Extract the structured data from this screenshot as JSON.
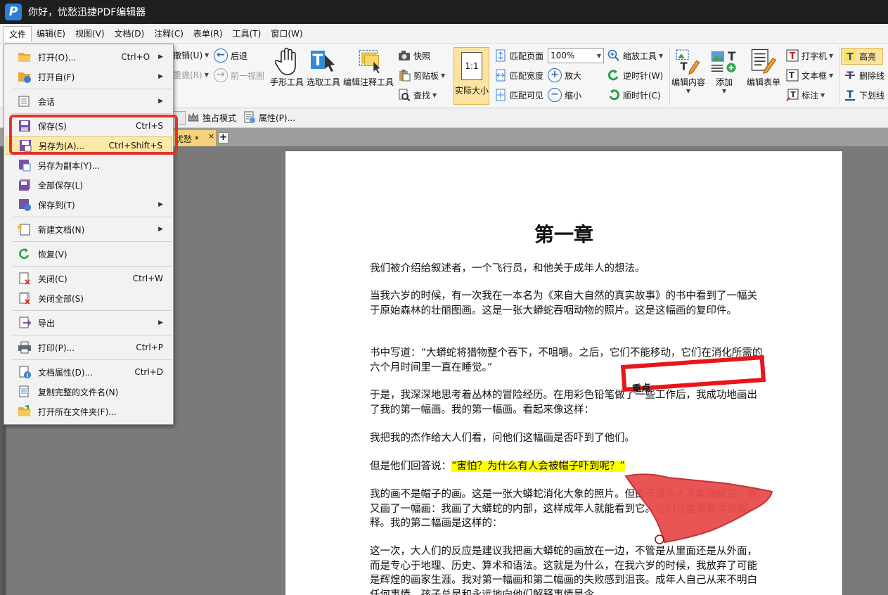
{
  "window": {
    "title": "你好，忧愁迅捷PDF编辑器",
    "logo": "P"
  },
  "menubar": [
    "文件",
    "编辑(E)",
    "视图(V)",
    "文档(D)",
    "注释(C)",
    "表单(R)",
    "工具(T)",
    "窗口(W)"
  ],
  "ribbon": {
    "undo": "撤销(U)",
    "redo": "重做(R)",
    "back": "后退",
    "forward": "前一视图",
    "hand_tool": "手形工具",
    "select_tool": "选取工具",
    "edit_annot_tool": "编辑注释工具",
    "snapshot": "快照",
    "clipboard": "剪贴板",
    "find": "查找",
    "actual_size": "实际大小",
    "actual_size_icon": "1:1",
    "fit_page": "匹配页面",
    "fit_width": "匹配宽度",
    "fit_visible": "匹配可见",
    "zoom_value": "100%",
    "zoom_tool": "缩放工具",
    "zoom_in": "放大",
    "zoom_out": "缩小",
    "rotate_ccw": "逆时针(W)",
    "rotate_cw": "顺时针(C)",
    "edit_content": "编辑内容",
    "add": "添加",
    "edit_form": "编辑表单",
    "typewriter": "打字机",
    "textbox": "文本框",
    "callout": "标注",
    "highlight": "高亮",
    "strikeout": "删除线",
    "underline": "下划线"
  },
  "subtoolbar": {
    "exclusive_mode": "独占模式",
    "properties": "属性(P)..."
  },
  "tab": {
    "label": "忧愁 *",
    "close": "×",
    "add": "+"
  },
  "file_menu": [
    {
      "label": "打开(O)...",
      "shortcut": "Ctrl+O",
      "arrow": true
    },
    {
      "label": "打开自(F)",
      "shortcut": "",
      "arrow": true
    },
    {
      "label": "会话",
      "shortcut": "",
      "arrow": true
    },
    {
      "label": "保存(S)",
      "shortcut": "Ctrl+S",
      "arrow": false
    },
    {
      "label": "另存为(A)...",
      "shortcut": "Ctrl+Shift+S",
      "arrow": false
    },
    {
      "label": "另存为副本(Y)...",
      "shortcut": "",
      "arrow": false
    },
    {
      "label": "全部保存(L)",
      "shortcut": "",
      "arrow": false
    },
    {
      "label": "保存到(T)",
      "shortcut": "",
      "arrow": true
    },
    {
      "label": "新建文档(N)",
      "shortcut": "",
      "arrow": true
    },
    {
      "label": "恢复(V)",
      "shortcut": "",
      "arrow": false
    },
    {
      "label": "关闭(C)",
      "shortcut": "Ctrl+W",
      "arrow": false
    },
    {
      "label": "关闭全部(S)",
      "shortcut": "",
      "arrow": false
    },
    {
      "label": "导出",
      "shortcut": "",
      "arrow": true
    },
    {
      "label": "打印(P)...",
      "shortcut": "Ctrl+P",
      "arrow": false
    },
    {
      "label": "文档属性(D)...",
      "shortcut": "Ctrl+D",
      "arrow": false
    },
    {
      "label": "复制完整的文件名(N)",
      "shortcut": "",
      "arrow": false
    },
    {
      "label": "打开所在文件夹(F)...",
      "shortcut": "",
      "arrow": false
    }
  ],
  "document": {
    "title": "第一章",
    "paragraphs": [
      "我们被介绍给叙述者，一个飞行员，和他关于成年人的想法。",
      "当我六岁的时候，有一次我在一本名为《来自大自然的真实故事》的书中看到了一幅关于原始森林的壮丽图画。这是一张大蟒蛇吞咽动物的照片。这是这幅画的复印件。",
      "书中写道：“大蟒蛇将猎物整个吞下，不咀嚼。之后，它们不能移动，它们在消化所需的六个月时间里一直在睡觉。”",
      "于是，我深深地思考着丛林的冒险经历。在用彩色铅笔做了一些工作后，我成功地画出了我的第一幅画。我的第一幅画。看起来像这样：",
      "我把我的杰作给大人们看，问他们这幅画是否吓到了他们。"
    ],
    "p6_prefix": "但是他们回答说：",
    "p6_highlight": "“害怕？为什么有人会被帽子吓到呢？”",
    "p7": "我的画不是帽子的画。这是一张大蟒蛇消化大象的照片。但由于成年人不能理解它，我又画了一幅画：我画了大蟒蛇的内部，这样成年人就能看到它。他们总是需要得到解释。我的第二幅画是这样的：",
    "p8": "这一次，大人们的反应是建议我把画大蟒蛇的画放在一边，不管是从里面还是从外面，而是专心于地理、历史、算术和语法。这就是为什么，在我六岁的时候，我放弃了可能是辉煌的画家生涯。我对第一幅画和第二幅画的失败感到沮丧。成年人自己从来不明白任何事情，孩子总是和永远地向他们解释事情是令",
    "annotation": "重点"
  }
}
